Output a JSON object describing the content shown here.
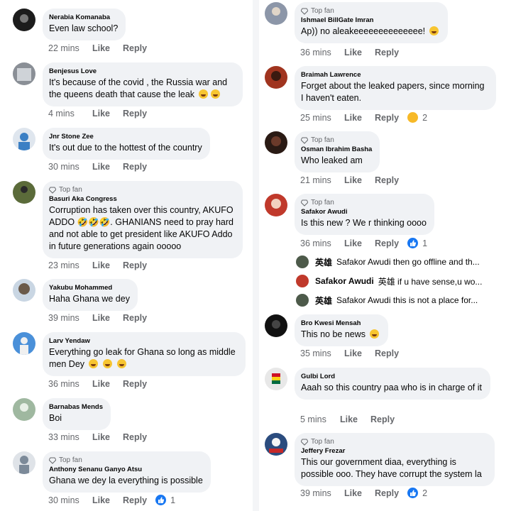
{
  "labels": {
    "like": "Like",
    "reply": "Reply",
    "top_fan": "Top fan"
  },
  "left_comments": [
    {
      "author": "Nerabia Komanaba",
      "text": "Even law school?",
      "time": "22 mins",
      "top_fan": false,
      "avatar_color": "#1c1c1c"
    },
    {
      "author": "Benjesus Love",
      "text": "It's because of the covid , the Russia war and the queens death that cause the leak",
      "time": "4 mins",
      "top_fan": false,
      "avatar_color": "#8a8f96"
    },
    {
      "author": "Jnr Stone Zee",
      "text": "It's out due to the hottest of the country",
      "time": "30 mins",
      "top_fan": false,
      "avatar_color": "#3b7fc4"
    },
    {
      "author": "Basuri Aka Congress",
      "text": "Corruption has taken over this country, AKUFO ADDO 🤣🤣🤣. GHANIANS need to pray hard and not able to get president like AKUFO Addo in future generations again ooooo",
      "time": "23 mins",
      "top_fan": true,
      "avatar_color": "#5b6b3a"
    },
    {
      "author": "Yakubu Mohammed",
      "text": "Haha Ghana we dey",
      "time": "39 mins",
      "top_fan": false,
      "avatar_color": "#6a5a4a"
    },
    {
      "author": "Larv Yendaw",
      "text": "Everything go leak for Ghana so long as middle men Dey",
      "time": "36 mins",
      "top_fan": false,
      "avatar_color": "#4a90d9"
    },
    {
      "author": "Barnabas Mends",
      "text": "Boi",
      "time": "33 mins",
      "top_fan": false,
      "avatar_color": "#9fb8a0"
    },
    {
      "author": "Anthony Senanu Ganyo Atsu",
      "text": "Ghana we dey la everything is possible",
      "time": "30 mins",
      "top_fan": true,
      "avatar_color": "#7c8a99",
      "reactions": {
        "type": "like",
        "count": "1"
      }
    }
  ],
  "right_comments": [
    {
      "author": "Ishmael BillGate Imran",
      "text": "Ap)) no aleakeeeeeeeeeeeeee!",
      "time": "36 mins",
      "top_fan": true,
      "avatar_color": "#8c96a8"
    },
    {
      "author": "Braimah Lawrence",
      "text": "Forget about the leaked papers, since morning I haven't eaten.",
      "time": "25 mins",
      "top_fan": false,
      "avatar_color": "#a0341f",
      "reactions": {
        "type": "haha",
        "count": "2"
      }
    },
    {
      "author": "Osman Ibrahim Basha",
      "text": "Who leaked am",
      "time": "21 mins",
      "top_fan": true,
      "avatar_color": "#6b3a2a"
    },
    {
      "author": "Safakor Awudi",
      "text": "Is this new ? We r thinking oooo",
      "time": "36 mins",
      "top_fan": true,
      "avatar_color": "#c0392b",
      "reactions": {
        "type": "like",
        "count": "1"
      }
    },
    {
      "author": "Bro Kwesi Mensah",
      "text": "This no be news",
      "time": "35 mins",
      "top_fan": false,
      "avatar_color": "#111111"
    },
    {
      "author": "Gulbi Lord",
      "text": "Aaah so this country paa who is in charge of it",
      "time": "5 mins",
      "top_fan": false,
      "avatar_color": "#e8e8e8"
    },
    {
      "author": "Jeffery Frezar",
      "text": "This our government diaa, everything is possible ooo. They have corrupt the system la",
      "time": "39 mins",
      "top_fan": true,
      "avatar_color": "#2b4c7e",
      "reactions": {
        "type": "like",
        "count": "2"
      }
    }
  ],
  "replies": [
    {
      "name": "英雄",
      "text": "Safakor Awudi then go offline and th...",
      "avatar_color": "#4d5a4a"
    },
    {
      "name": "Safakor Awudi",
      "text": "英雄  if u have sense,u wo...",
      "avatar_color": "#c0392b"
    },
    {
      "name": "英雄",
      "text": "Safakor Awudi this is not a place for...",
      "avatar_color": "#4d5a4a"
    }
  ]
}
